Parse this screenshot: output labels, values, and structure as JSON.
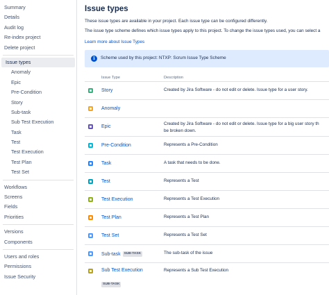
{
  "sidebar": {
    "top": [
      "Summary",
      "Details",
      "Audit log",
      "Re-index project",
      "Delete project"
    ],
    "issue_types": "Issue types",
    "sub": [
      "Anomaly",
      "Epic",
      "Pre-Condition",
      "Story",
      "Sub-task",
      "Sub Test Execution",
      "Task",
      "Test",
      "Test Execution",
      "Test Plan",
      "Test Set"
    ],
    "group2": [
      "Workflows",
      "Screens",
      "Fields",
      "Priorities"
    ],
    "group3": [
      "Versions",
      "Components"
    ],
    "group4": [
      "Users and roles",
      "Permissions",
      "Issue Security"
    ]
  },
  "main": {
    "title": "Issue types",
    "para1": "These issue types are available in your project. Each issue type can be configured differently.",
    "para2": "The issue type scheme defines which issue types apply to this project. To change the issue types used, you can select a",
    "learn_more": "Learn more about Issue Types",
    "banner": "Scheme used by this project: NTXP: Scrum Issue Type Scheme",
    "col_type": "Issue Type",
    "col_desc": "Description"
  },
  "rows": [
    {
      "name": "Story",
      "color": "#36b37e",
      "desc": [
        "Created by Jira Software - do not edit or delete. Issue type for a user story."
      ]
    },
    {
      "name": "Anomaly",
      "color": "#f5a623",
      "desc": [
        ""
      ]
    },
    {
      "name": "Epic",
      "color": "#6554c0",
      "desc": [
        "Created by Jira Software - do not edit or delete. Issue type for a big user story th",
        "be broken down."
      ]
    },
    {
      "name": "Pre-Condition",
      "color": "#00b8d9",
      "desc": [
        "Represents a Pre-Condition"
      ]
    },
    {
      "name": "Task",
      "color": "#2684ff",
      "desc": [
        "A task that needs to be done."
      ]
    },
    {
      "name": "Test",
      "color": "#00a3bf",
      "desc": [
        "Represents a Test"
      ]
    },
    {
      "name": "Test Execution",
      "color": "#8fb21a",
      "desc": [
        "Represents a Test Execution"
      ]
    },
    {
      "name": "Test Plan",
      "color": "#ff8b00",
      "desc": [
        "Represents a Test Plan"
      ]
    },
    {
      "name": "Test Set",
      "color": "#4c9aff",
      "desc": [
        "Represents a Test Set"
      ]
    },
    {
      "name": "Sub-task",
      "color": "#4c9aff",
      "badge": "SUB-TASK",
      "desc": [
        "The sub-task of the issue"
      ]
    },
    {
      "name": "Sub Test Execution",
      "color": "#b8a21a",
      "badge": "SUB-TASK",
      "desc": [
        "Represents a Sub Test Execution"
      ]
    }
  ]
}
